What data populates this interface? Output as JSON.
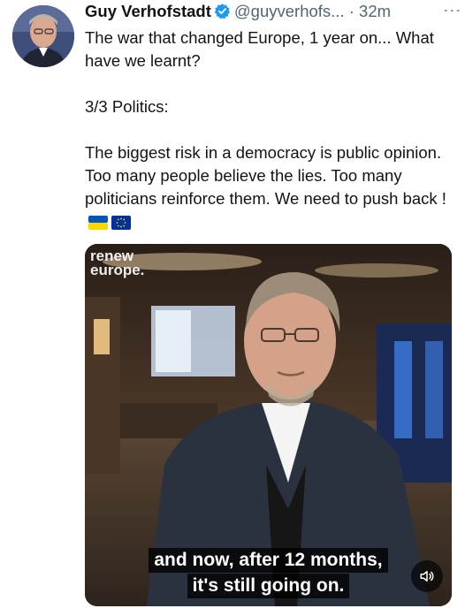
{
  "author": {
    "name": "Guy Verhofstadt",
    "handle": "@guyverhofs...",
    "separator": "·",
    "time": "32m"
  },
  "tweet": {
    "paragraphs": [
      "The war that changed Europe, 1 year on... What have we learnt?",
      "3/3 Politics:",
      "The biggest risk in a democracy is public opinion. Too many people believe the lies. Too many politicians reinforce them. We need to push back !"
    ],
    "emoji": [
      "ukraine-flag",
      "eu-flag"
    ]
  },
  "media": {
    "logo_line1": "renew",
    "logo_line2": "europe.",
    "subtitle_line1": "and now, after 12 months,",
    "subtitle_line2": "it's still going on."
  },
  "colors": {
    "verified_blue": "#1d9bf0",
    "secondary_text": "#536471",
    "ukraine_blue": "#0057b7",
    "ukraine_yellow": "#ffd700",
    "eu_blue": "#003399"
  }
}
